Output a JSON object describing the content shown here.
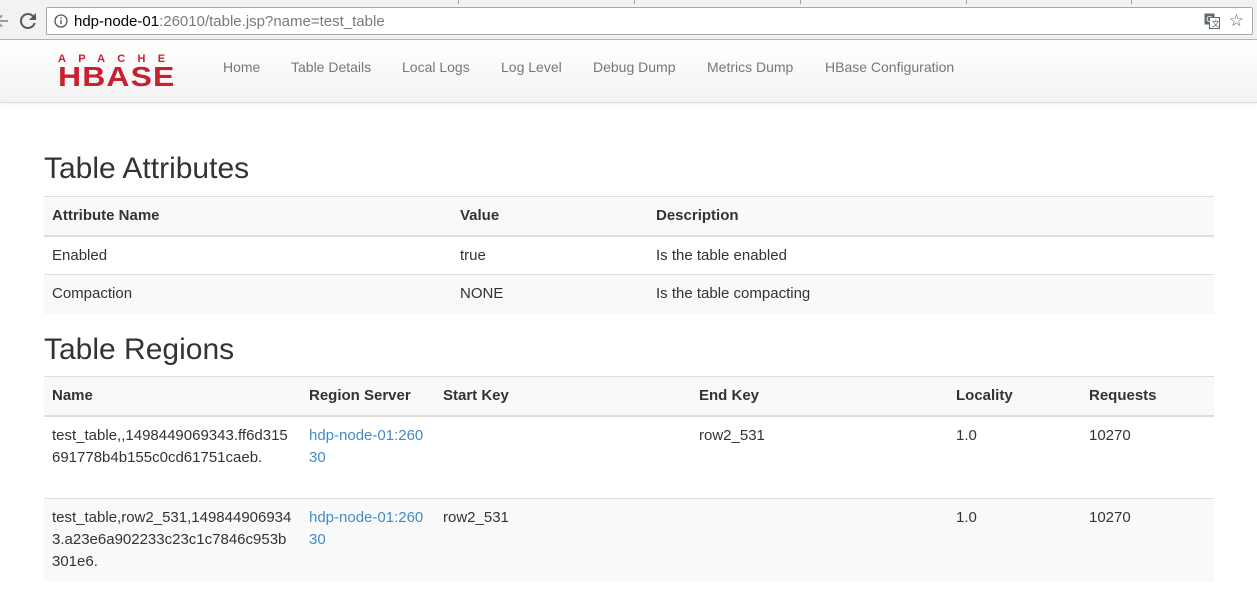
{
  "browser": {
    "url_host": "hdp-node-01",
    "url_rest": ":26010/table.jsp?name=test_table"
  },
  "navbar": {
    "logo_top": "APACHE",
    "logo_main": "HBASE",
    "links": [
      "Home",
      "Table Details",
      "Local Logs",
      "Log Level",
      "Debug Dump",
      "Metrics Dump",
      "HBase Configuration"
    ]
  },
  "attributes": {
    "title": "Table Attributes",
    "headers": [
      "Attribute Name",
      "Value",
      "Description"
    ],
    "rows": [
      [
        "Enabled",
        "true",
        "Is the table enabled"
      ],
      [
        "Compaction",
        "NONE",
        "Is the table compacting"
      ]
    ]
  },
  "regions": {
    "title": "Table Regions",
    "headers": [
      "Name",
      "Region Server",
      "Start Key",
      "End Key",
      "Locality",
      "Requests"
    ],
    "rows": [
      {
        "name": "test_table,,1498449069343.ff6d315691778b4b155c0cd61751caeb.",
        "server": "hdp-node-01:26030",
        "start_key": "",
        "end_key": "row2_531",
        "locality": "1.0",
        "requests": "10270"
      },
      {
        "name": "test_table,row2_531,1498449069343.a23e6a902233c23c1c7846c953b301e6.",
        "server": "hdp-node-01:26030",
        "start_key": "row2_531",
        "end_key": "",
        "locality": "1.0",
        "requests": "10270"
      }
    ]
  },
  "colors": {
    "logo_red": "#c8202f",
    "link_blue": "#428bca",
    "nav_text": "#777777"
  }
}
